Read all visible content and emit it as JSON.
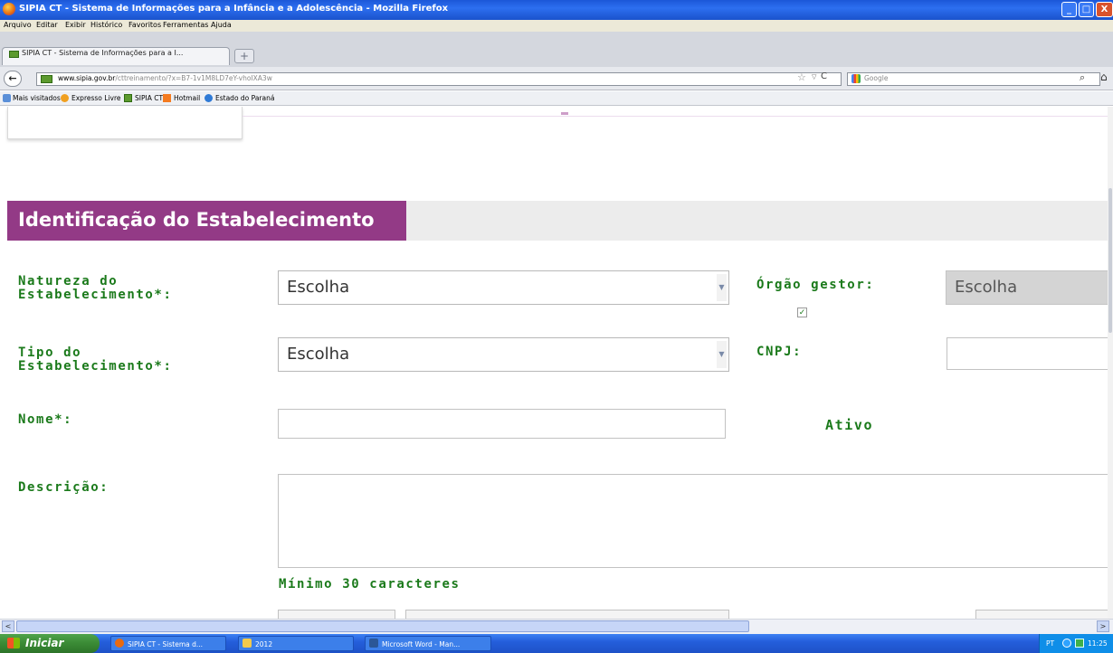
{
  "window": {
    "title": "SIPIA CT - Sistema de Informações para a Infância e a Adolescência - Mozilla Firefox",
    "min_label": "_",
    "max_label": "□",
    "close_label": "X"
  },
  "menu": [
    "Arquivo",
    "Editar",
    "Exibir",
    "Histórico",
    "Favoritos",
    "Ferramentas",
    "Ajuda"
  ],
  "tab": {
    "label": "SIPIA CT - Sistema de Informações para a I...",
    "new_tab": "+"
  },
  "nav": {
    "back": "←",
    "url_domain": "www.sipia.gov.br",
    "url_path": "/cttreinamento/?x=B7-1v1M8LD7eY-vhoIXA3w",
    "star": "☆",
    "dropdown": "▽",
    "reload": "C",
    "search_placeholder": "Google",
    "search_icon": "⌕",
    "home_icon": "⌂"
  },
  "bookmarks": [
    "Mais visitados",
    "Expresso Livre",
    "SIPIA CT",
    "Hotmail",
    "Estado do Paraná"
  ],
  "form": {
    "section_title": "Identificação do Estabelecimento",
    "natureza_label_1": "Natureza do",
    "natureza_label_2": "Estabelecimento*:",
    "natureza_value": "Escolha",
    "orgao_label": "Órgão gestor:",
    "orgao_value": "Escolha",
    "tipo_label_1": "Tipo do",
    "tipo_label_2": "Estabelecimento*:",
    "tipo_value": "Escolha",
    "cnpj_label": "CNPJ:",
    "nome_label": "Nome*:",
    "ativo_label": "Ativo",
    "ativo_checked": true,
    "descricao_label": "Descrição:",
    "min_chars_hint": "Mínimo 30 caracteres"
  },
  "scrollbar": {
    "left": "<",
    "right": ">"
  },
  "taskbar": {
    "start_label": "Iniciar",
    "tasks": [
      "SIPIA CT - Sistema d...",
      "2012",
      "Microsoft Word - Man..."
    ],
    "language": "PT",
    "time": "11:25"
  },
  "colors": {
    "section_purple": "#933a86",
    "label_green": "#1b7a1b",
    "xp_blue": "#245edb",
    "start_green": "#3a8a35"
  }
}
